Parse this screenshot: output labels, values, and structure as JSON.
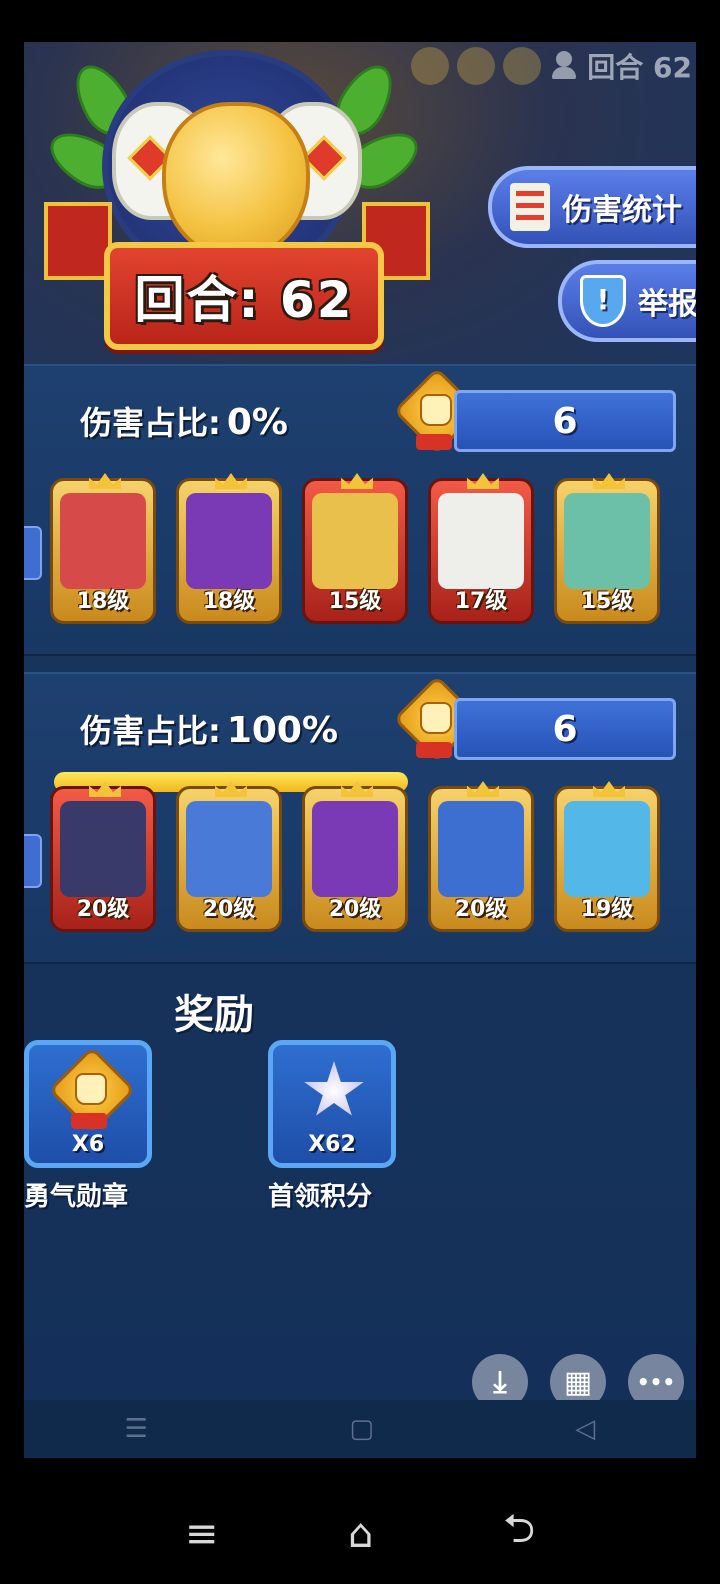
{
  "header": {
    "round_top": "回合 62",
    "round_banner": "回合: 62"
  },
  "buttons": {
    "damage_stats": "伤害统计",
    "report": "举报"
  },
  "teams": [
    {
      "damage_label": "伤害占比:",
      "damage_value": "0%",
      "damage_fraction": 0,
      "medals": "6",
      "heroes": [
        {
          "level": "18级",
          "frame": "gold",
          "color": "#d64a4a"
        },
        {
          "level": "18级",
          "frame": "gold",
          "color": "#7a3ab5"
        },
        {
          "level": "15级",
          "frame": "gold",
          "color": "#e9c04b"
        },
        {
          "level": "17级",
          "frame": "gold",
          "color": "#eeeeea"
        },
        {
          "level": "15级",
          "frame": "gold",
          "color": "#6cc0a8"
        }
      ]
    },
    {
      "damage_label": "伤害占比:",
      "damage_value": "100%",
      "damage_fraction": 1,
      "medals": "6",
      "heroes": [
        {
          "level": "20级",
          "frame": "red",
          "color": "#3a3a6a"
        },
        {
          "level": "20级",
          "frame": "gold",
          "color": "#4a7ad8"
        },
        {
          "level": "20级",
          "frame": "gold",
          "color": "#7a3ab5"
        },
        {
          "level": "20级",
          "frame": "gold",
          "color": "#3d6fd0"
        },
        {
          "level": "19级",
          "frame": "gold",
          "color": "#53b8e8"
        }
      ]
    }
  ],
  "rewards": {
    "title": "奖励",
    "items": [
      {
        "qty": "X6",
        "label": "勇气勋章"
      },
      {
        "qty": "X62",
        "label": "首领积分"
      }
    ]
  },
  "fab": {
    "download": "⤓",
    "grid": "▦",
    "more": "•••"
  },
  "inner_nav": [
    "☰",
    "▢",
    "◁"
  ],
  "system_nav": [
    "≡",
    "⌂",
    "⮌"
  ],
  "icons": [
    "user-icon",
    "handshake-icon",
    "list-icon",
    "shield-icon",
    "fist-medal-icon",
    "star-badge-icon",
    "download-icon",
    "grid-icon",
    "more-icon",
    "menu-icon",
    "home-icon",
    "back-icon"
  ]
}
